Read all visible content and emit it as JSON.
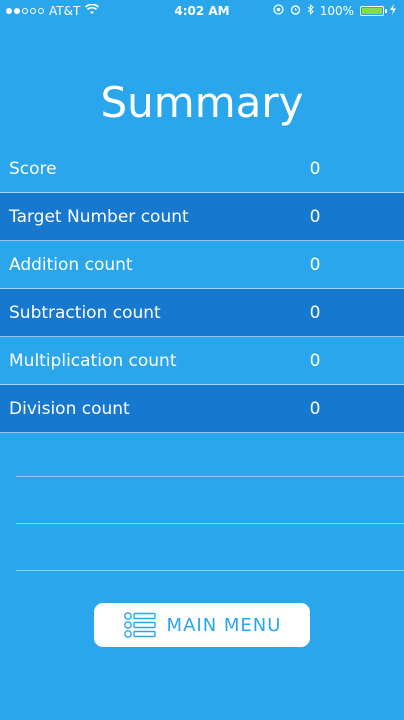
{
  "status_bar": {
    "carrier": "AT&T",
    "time": "4:02 AM",
    "battery": "100%",
    "battery_level": 1.0,
    "signal_dots_filled": 2,
    "signal_dots_total": 5,
    "icons": [
      "wifi-icon",
      "lock-rotation-icon",
      "alarm-icon",
      "bluetooth-icon",
      "battery-icon",
      "charging-icon"
    ]
  },
  "page": {
    "title": "Summary"
  },
  "stats": [
    {
      "label": "Score",
      "value": "0",
      "highlight": false
    },
    {
      "label": "Target Number count",
      "value": "0",
      "highlight": true
    },
    {
      "label": "Addition count",
      "value": "0",
      "highlight": false
    },
    {
      "label": "Subtraction count",
      "value": "0",
      "highlight": true
    },
    {
      "label": "Multiplication count",
      "value": "0",
      "highlight": false
    },
    {
      "label": "Division count",
      "value": "0",
      "highlight": true
    }
  ],
  "main_menu_button": {
    "label": "MAIN MENU",
    "icon": "list-icon"
  },
  "colors": {
    "background": "#2aa7ec",
    "row_highlight": "#1778cf",
    "button_bg": "#ffffff",
    "button_text": "#2aa7ec",
    "battery_fill": "#7ee04a"
  }
}
